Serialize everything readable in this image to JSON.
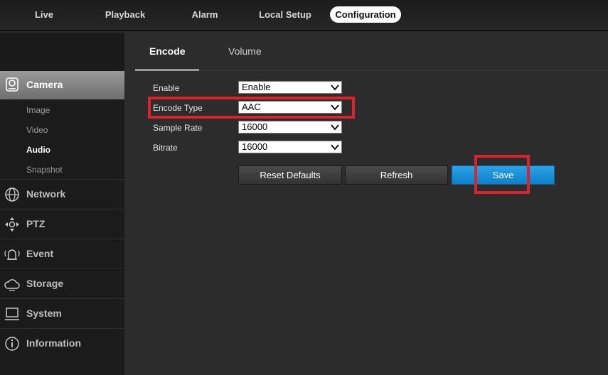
{
  "topnav": {
    "tabs": [
      {
        "label": "Live"
      },
      {
        "label": "Playback"
      },
      {
        "label": "Alarm"
      },
      {
        "label": "Local Setup"
      },
      {
        "label": "Configuration"
      }
    ]
  },
  "sidebar": {
    "camera": {
      "label": "Camera",
      "icon": "camera-icon"
    },
    "camera_subitems": [
      {
        "label": "Image"
      },
      {
        "label": "Video"
      },
      {
        "label": "Audio"
      },
      {
        "label": "Snapshot"
      }
    ],
    "items": [
      {
        "label": "Network",
        "icon": "globe-icon"
      },
      {
        "label": "PTZ",
        "icon": "ptz-icon"
      },
      {
        "label": "Event",
        "icon": "alarm-icon"
      },
      {
        "label": "Storage",
        "icon": "cloud-icon"
      },
      {
        "label": "System",
        "icon": "monitor-icon"
      },
      {
        "label": "Information",
        "icon": "info-icon"
      }
    ]
  },
  "content": {
    "subtabs": [
      {
        "label": "Encode"
      },
      {
        "label": "Volume"
      }
    ],
    "form": {
      "enable": {
        "label": "Enable",
        "value": "Enable"
      },
      "encode_type": {
        "label": "Encode Type",
        "value": "AAC"
      },
      "sample_rate": {
        "label": "Sample Rate",
        "value": "16000"
      },
      "bitrate": {
        "label": "Bitrate",
        "value": "16000"
      }
    },
    "buttons": {
      "reset": "Reset Defaults",
      "refresh": "Refresh",
      "save": "Save"
    }
  },
  "colors": {
    "accent": "#1a93dc",
    "highlight": "#d9242c"
  }
}
